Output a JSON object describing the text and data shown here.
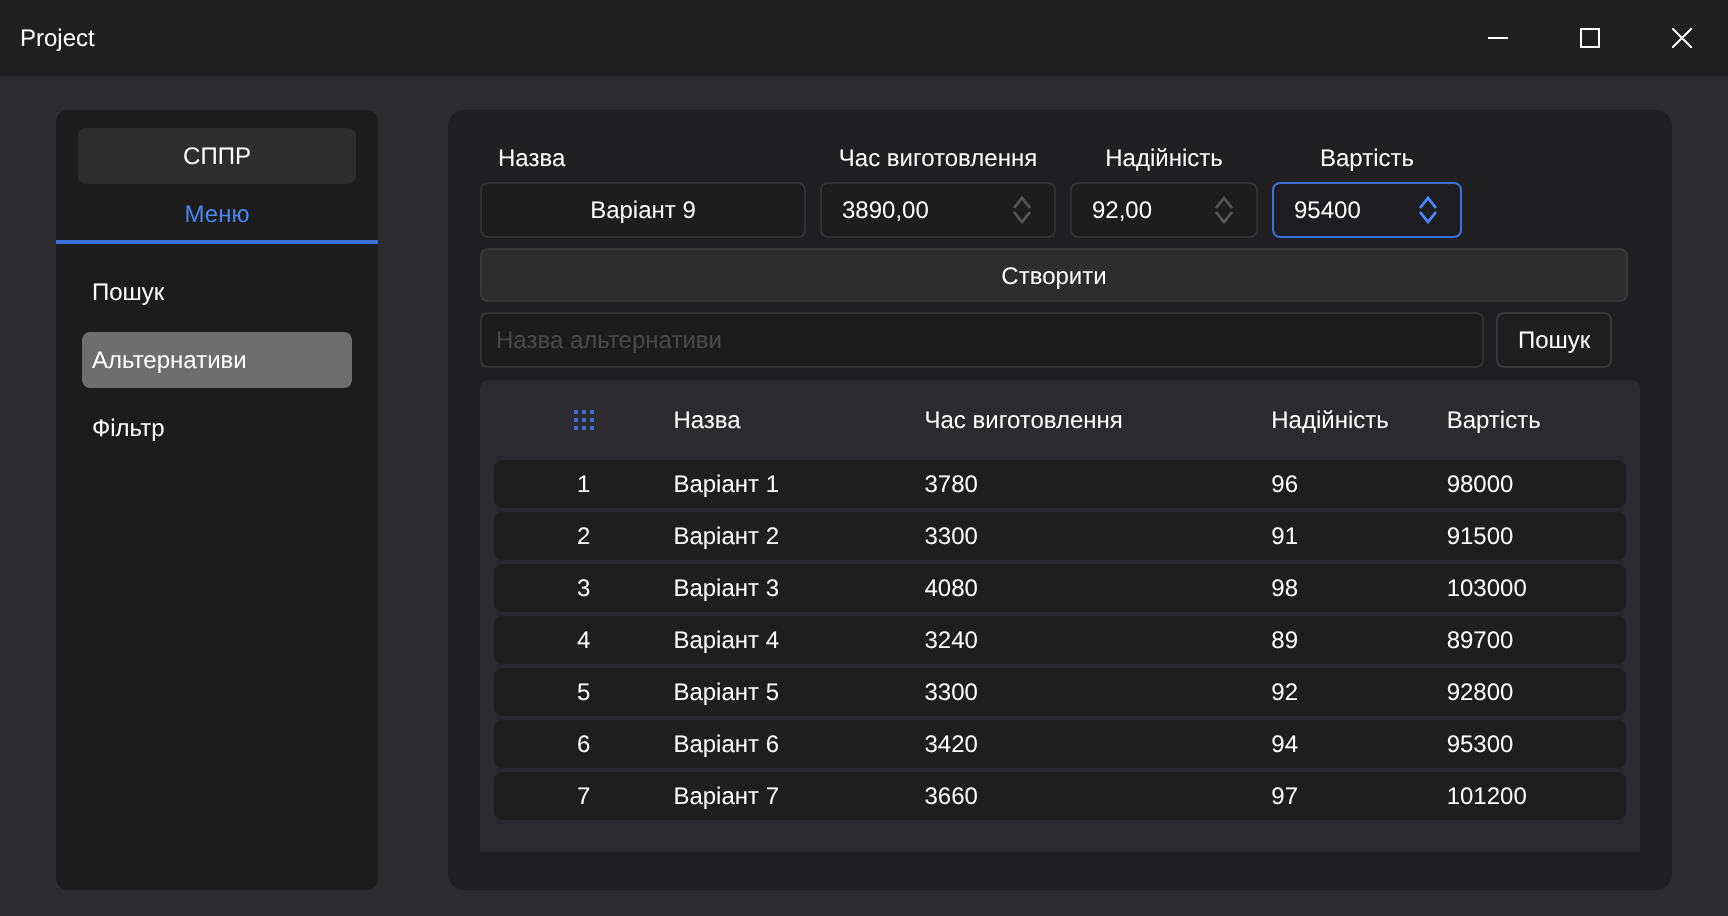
{
  "window": {
    "title": "Project"
  },
  "sidebar": {
    "title": "СППР",
    "tab": "Меню",
    "items": [
      {
        "label": "Пошук",
        "selected": false
      },
      {
        "label": "Альтернативи",
        "selected": true
      },
      {
        "label": "Фільтр",
        "selected": false
      }
    ]
  },
  "form": {
    "fields": [
      {
        "label": "Назва",
        "value": "Варіант 9",
        "kind": "text",
        "focused": false
      },
      {
        "label": "Час виготовлення",
        "value": "3890,00",
        "kind": "spin",
        "focused": false
      },
      {
        "label": "Надійність",
        "value": "92,00",
        "kind": "spin",
        "focused": false
      },
      {
        "label": "Вартість",
        "value": "95400",
        "kind": "spin",
        "focused": true
      }
    ],
    "create_button": "Створити"
  },
  "search": {
    "placeholder": "Назва альтернативи",
    "button": "Пошук"
  },
  "table": {
    "columns": [
      "",
      "Назва",
      "Час виготовлення",
      "Надійність",
      "Вартість"
    ],
    "rows": [
      [
        "1",
        "Варіант 1",
        "3780",
        "96",
        "98000"
      ],
      [
        "2",
        "Варіант 2",
        "3300",
        "91",
        "91500"
      ],
      [
        "3",
        "Варіант 3",
        "4080",
        "98",
        "103000"
      ],
      [
        "4",
        "Варіант 4",
        "3240",
        "89",
        "89700"
      ],
      [
        "5",
        "Варіант 5",
        "3300",
        "92",
        "92800"
      ],
      [
        "6",
        "Варіант 6",
        "3420",
        "94",
        "95300"
      ],
      [
        "7",
        "Варіант 7",
        "3660",
        "97",
        "101200"
      ]
    ]
  }
}
